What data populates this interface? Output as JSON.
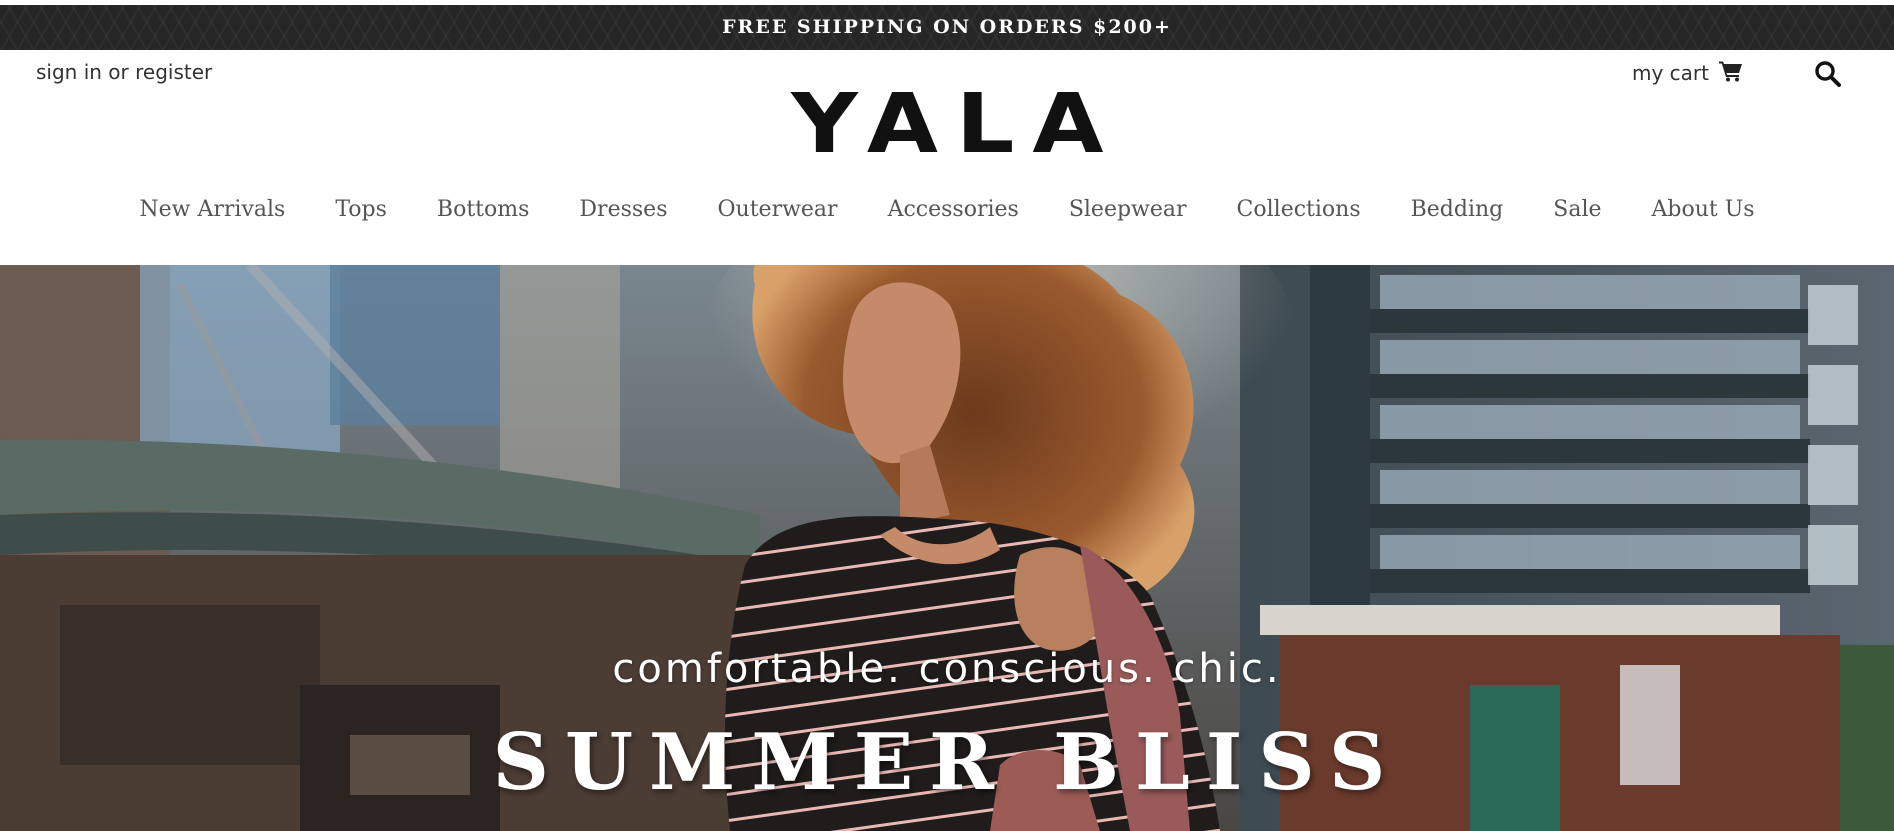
{
  "announcement": {
    "text": "FREE SHIPPING ON ORDERS $200+"
  },
  "header": {
    "account_link": "sign in or register",
    "cart_label": "my cart",
    "cart_icon": "shopping-cart-icon",
    "search_icon": "search-icon",
    "logo": "YALA"
  },
  "nav": {
    "items": [
      {
        "label": "New Arrivals"
      },
      {
        "label": "Tops"
      },
      {
        "label": "Bottoms"
      },
      {
        "label": "Dresses"
      },
      {
        "label": "Outerwear"
      },
      {
        "label": "Accessories"
      },
      {
        "label": "Sleepwear"
      },
      {
        "label": "Collections"
      },
      {
        "label": "Bedding"
      },
      {
        "label": "Sale"
      },
      {
        "label": "About Us"
      }
    ]
  },
  "hero": {
    "tagline": "comfortable. conscious. chic.",
    "title": "SUMMER BLISS"
  },
  "colors": {
    "announcement_bg": "#262626",
    "text_dark": "#333333",
    "nav_text": "#555555",
    "hero_text": "#ffffff"
  }
}
